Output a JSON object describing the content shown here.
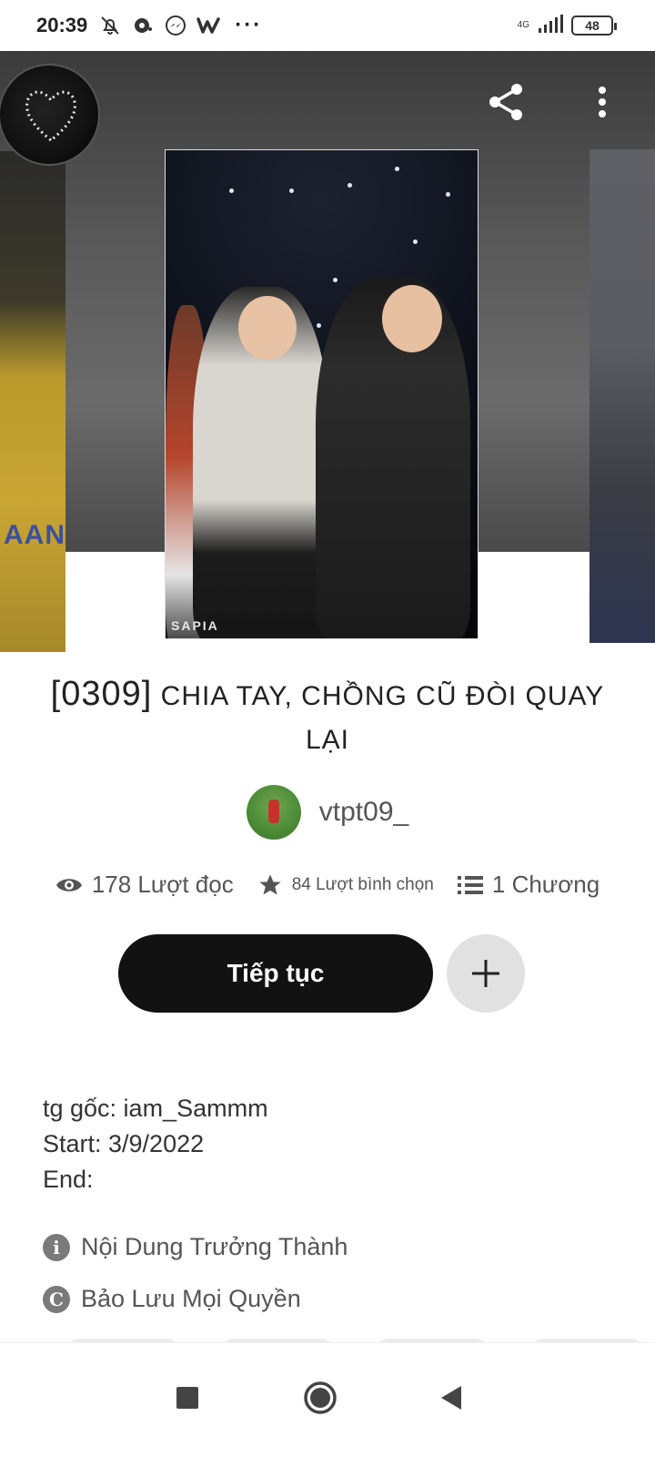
{
  "status_bar": {
    "time": "20:39",
    "network_label": "4G",
    "battery_level": "48",
    "more": "···",
    "icons": [
      "bell-off-icon",
      "record-icon",
      "messenger-icon",
      "wattpad-icon",
      "signal-icon",
      "battery-icon"
    ]
  },
  "hero": {
    "cover_watermark": "SAPIA",
    "cover_left_text": "AAN",
    "actions": [
      "share-icon",
      "more-vert-icon"
    ]
  },
  "story": {
    "title_number": "[0309]",
    "title_text": "CHIA TAY, CHỒNG CŨ ĐÒI QUAY LẠI",
    "author": "vtpt09_",
    "reads": "178 Lượt đọc",
    "votes": "84 Lượt bình chọn",
    "parts": "1 Chương"
  },
  "buttons": {
    "continue_label": "Tiếp tục",
    "add_icon": "plus-icon"
  },
  "description": {
    "line1": "tg gốc: iam_Sammm",
    "line2": "Start: 3/9/2022",
    "line3": "End:"
  },
  "meta": {
    "mature": "Nội Dung Trưởng Thành",
    "mature_icon_glyph": "i",
    "copyright": "Bảo Lưu Mọi Quyền",
    "copyright_icon_glyph": "C"
  },
  "nav": {
    "icons": [
      "recents-icon",
      "home-icon",
      "back-icon"
    ]
  }
}
